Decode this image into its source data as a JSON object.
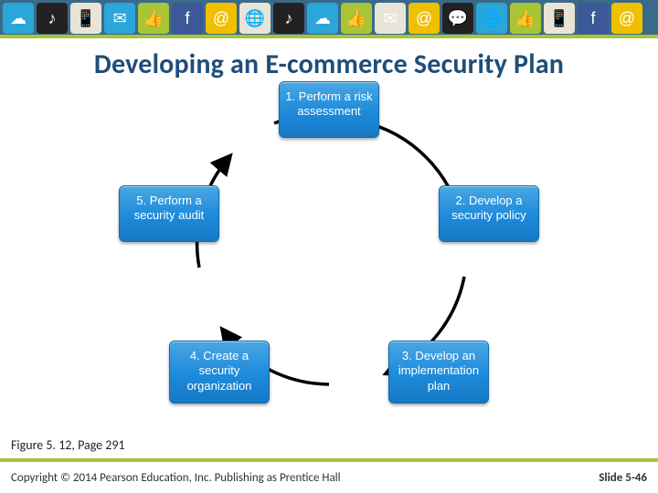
{
  "title": "Developing an E-commerce Security Plan",
  "steps": [
    {
      "num": "1.",
      "label": "Perform a risk assessment"
    },
    {
      "num": "2.",
      "label": "Develop a security policy"
    },
    {
      "num": "3.",
      "label": "Develop an implementation plan"
    },
    {
      "num": "4.",
      "label": "Create a security organization"
    },
    {
      "num": "5.",
      "label": "Perform a security audit"
    }
  ],
  "caption": "Figure 5. 12, Page 291",
  "footer": {
    "copyright": "Copyright © 2014 Pearson Education, Inc. Publishing as Prentice Hall",
    "slide": "Slide 5-46"
  },
  "banner_tiles": [
    {
      "c": "#2aa6d8",
      "g": "☁"
    },
    {
      "c": "#222",
      "g": "♪"
    },
    {
      "c": "#e8e4d8",
      "g": "📱"
    },
    {
      "c": "#2aa6d8",
      "g": "✉"
    },
    {
      "c": "#a9c437",
      "g": "👍"
    },
    {
      "c": "#3b5998",
      "g": "f"
    },
    {
      "c": "#f0c000",
      "g": "@"
    },
    {
      "c": "#e8e4d8",
      "g": "🌐"
    },
    {
      "c": "#222",
      "g": "♪"
    },
    {
      "c": "#2aa6d8",
      "g": "☁"
    },
    {
      "c": "#a9c437",
      "g": "👍"
    },
    {
      "c": "#e8e4d8",
      "g": "✉"
    },
    {
      "c": "#f0c000",
      "g": "@"
    },
    {
      "c": "#222",
      "g": "💬"
    },
    {
      "c": "#2aa6d8",
      "g": "🌐"
    },
    {
      "c": "#a9c437",
      "g": "👍"
    },
    {
      "c": "#e8e4d8",
      "g": "📱"
    },
    {
      "c": "#3b5998",
      "g": "f"
    },
    {
      "c": "#f0c000",
      "g": "@"
    }
  ]
}
